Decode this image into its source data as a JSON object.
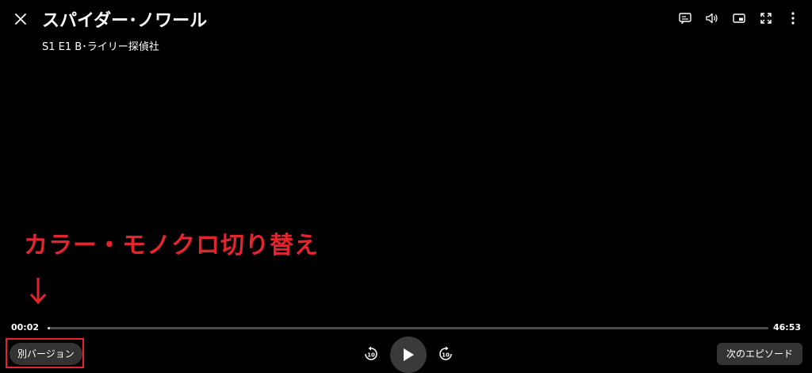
{
  "header": {
    "title": "スパイダー･ノワール",
    "episode": "S1 E1 B･ライリー探偵社"
  },
  "top_controls": [
    {
      "name": "subtitles-icon"
    },
    {
      "name": "volume-icon"
    },
    {
      "name": "picture-in-picture-icon"
    },
    {
      "name": "fullscreen-icon"
    },
    {
      "name": "more-options-icon"
    }
  ],
  "annotation": {
    "text": "カラー・モノクロ切り替え",
    "color": "#e3262d"
  },
  "playback": {
    "elapsed": "00:02",
    "total": "46:53",
    "progress_fraction": 0.0007
  },
  "controls": {
    "alt_version_label": "別バージョン",
    "skip_back_label": "10",
    "skip_forward_label": "10",
    "next_episode_label": "次のエピソード"
  },
  "colors": {
    "accent": "#e3262d",
    "background": "#000000",
    "button_bg": "#333333"
  }
}
